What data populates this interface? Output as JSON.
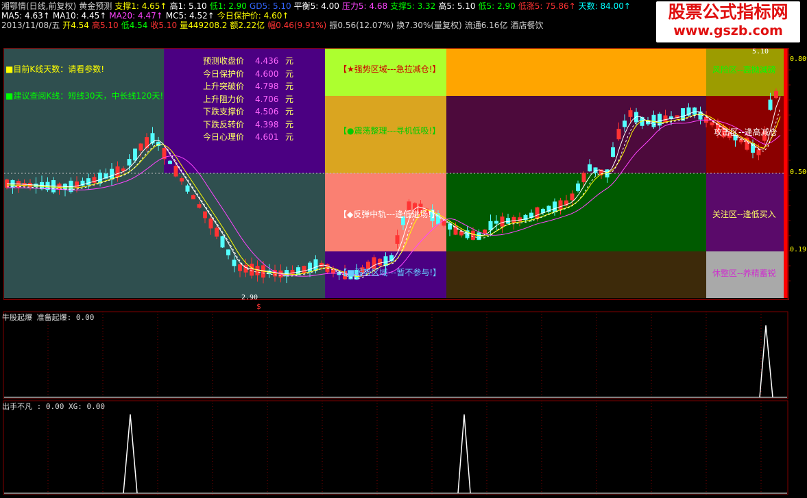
{
  "header": {
    "line1": [
      {
        "text": "湘鄂情(日线,前复权)",
        "color": "#d0d0d0"
      },
      {
        "text": "黄金预测",
        "color": "#d0d0d0"
      },
      {
        "text": "支撑1: 4.65↑",
        "color": "#ffff00"
      },
      {
        "text": "高1: 5.10",
        "color": "#ffffff"
      },
      {
        "text": "低1: 2.90",
        "color": "#00ff00"
      },
      {
        "text": "GD5: 5.10",
        "color": "#3366ff"
      },
      {
        "text": "平衡5: 4.00",
        "color": "#ffffff"
      },
      {
        "text": "压力5: 4.68",
        "color": "#ff44ff"
      },
      {
        "text": "支撑5: 3.32",
        "color": "#00ff00"
      },
      {
        "text": "高5: 5.10",
        "color": "#ffffff"
      },
      {
        "text": "低5: 2.90",
        "color": "#00ff00"
      },
      {
        "text": "低涨5: 75.86↑",
        "color": "#ff3333"
      },
      {
        "text": "天数: 84.00↑",
        "color": "#00ffff"
      }
    ],
    "line2": [
      {
        "text": "MA5: 4.63↑",
        "color": "#ffffff"
      },
      {
        "text": "MA10: 4.45↑",
        "color": "#ffffff"
      },
      {
        "text": "MA20: 4.47↑",
        "color": "#ff44ff"
      },
      {
        "text": "MC5: 4.52↑",
        "color": "#ffffff"
      },
      {
        "text": "今日保护价: 4.60↑",
        "color": "#ffff00"
      }
    ],
    "line3": [
      {
        "text": "2013/11/08/五",
        "color": "#d0d0d0"
      },
      {
        "text": "开4.54",
        "color": "#ffff00"
      },
      {
        "text": "高5.10",
        "color": "#ff3333"
      },
      {
        "text": "低4.54",
        "color": "#00ff00"
      },
      {
        "text": "收5.10",
        "color": "#ff3333"
      },
      {
        "text": "量449208.2",
        "color": "#ffff00"
      },
      {
        "text": "额2.22亿",
        "color": "#ffff00"
      },
      {
        "text": "幅0.46(9.91%)",
        "color": "#ff3333"
      },
      {
        "text": "振0.56(12.07%)",
        "color": "#d0d0d0"
      },
      {
        "text": "换7.30%(量复权)",
        "color": "#d0d0d0"
      },
      {
        "text": "流通6.16亿",
        "color": "#d0d0d0"
      },
      {
        "text": "酒店餐饮",
        "color": "#d0d0d0"
      }
    ]
  },
  "watermark": {
    "line1": "股票公式指标网",
    "line2": "www.gszb.com"
  },
  "info": {
    "days_label": "■目前K线天数：请看参数!",
    "advice_label": "■建议查阅K线：短线30天，中长线120天!"
  },
  "predictions": [
    {
      "name": "预测收盘价",
      "value": "4.436",
      "unit": "元"
    },
    {
      "name": "今日保护价",
      "value": "4.600",
      "unit": "元"
    },
    {
      "name": "上升突破价",
      "value": "4.798",
      "unit": "元"
    },
    {
      "name": "上升阻力价",
      "value": "4.706",
      "unit": "元"
    },
    {
      "name": "下跌支撑价",
      "value": "4.506",
      "unit": "元"
    },
    {
      "name": "下跌反转价",
      "value": "4.398",
      "unit": "元"
    },
    {
      "name": "今日心理价",
      "value": "4.601",
      "unit": "元"
    }
  ],
  "zones": {
    "strong": "【★强势区域---急拉减仓!】",
    "consolidation": "【●震荡整理---寻机低吸!】",
    "rebound": "【◆反弹中轨---逢低进场!】",
    "weak": "【■弱势区域---暂不参与!】",
    "risk": "风险区--高抛減磅",
    "attack": "攻击区--逢高减仓",
    "watch": "关注区--逢低买入",
    "rest": "休整区--养精蓄锐"
  },
  "axis": {
    "high_marker": "5.10",
    "low_marker": "2.90",
    "r1": "0.809",
    "r2": "0.500",
    "r3": "0.191",
    "s_marker": "$"
  },
  "panel2": {
    "title": "牛股起爆",
    "sub": "准备起爆: 0.00"
  },
  "panel3": {
    "title": "出手不凡",
    "sub": ": 0.00 XG: 0.00"
  },
  "colors": {
    "up": "#ff3333",
    "down": "#54ffff",
    "ma5": "#ffffff",
    "ma10": "#ffff00",
    "ma20": "#ff44ff",
    "grid": "#800000"
  }
}
